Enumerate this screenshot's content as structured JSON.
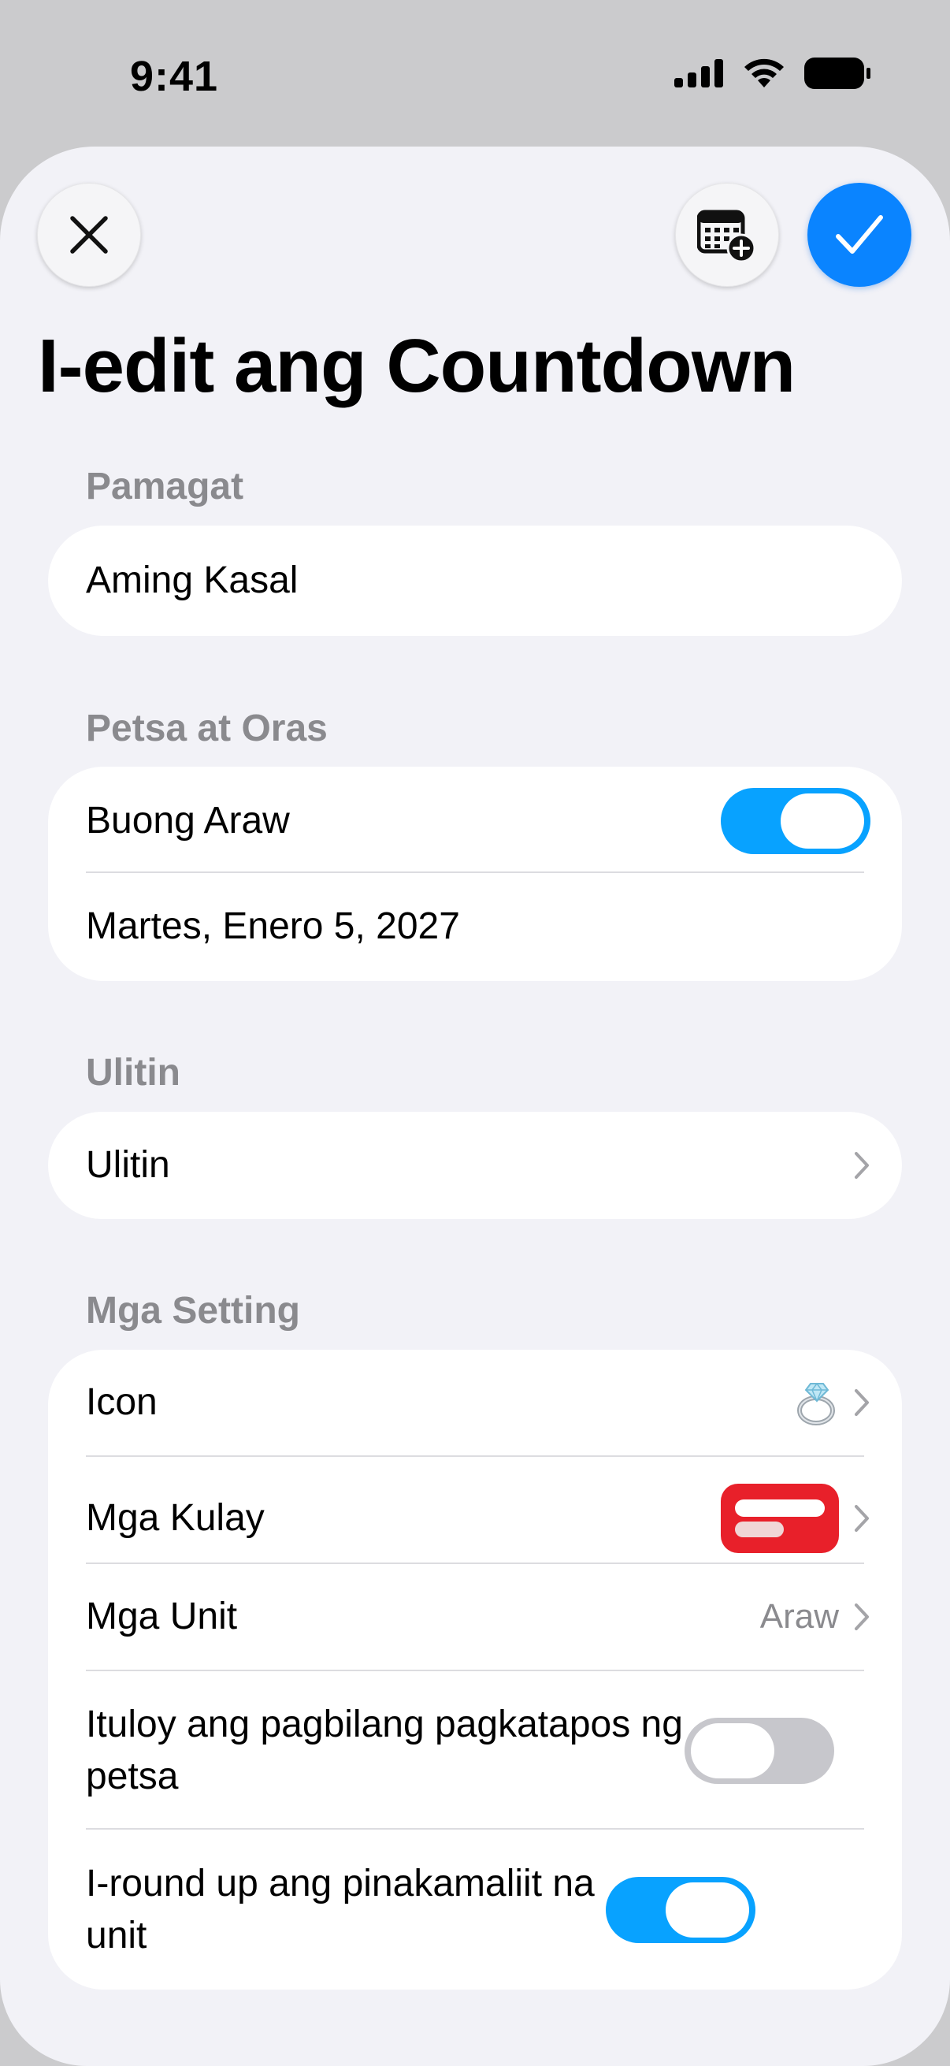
{
  "status_bar": {
    "time": "9:41"
  },
  "header": {
    "title": "I-edit ang Countdown",
    "close_icon": "close-icon",
    "calendar_icon": "calendar-add-icon",
    "confirm_icon": "checkmark-icon",
    "accent_color": "#0a84ff"
  },
  "sections": {
    "title": {
      "label": "Pamagat",
      "input_value": "Aming Kasal"
    },
    "date_time": {
      "label": "Petsa at Oras",
      "all_day_label": "Buong Araw",
      "all_day_on": true,
      "date_text": "Martes, Enero 5, 2027"
    },
    "repeat": {
      "label": "Ulitin",
      "row_label": "Ulitin"
    },
    "settings": {
      "label": "Mga Setting",
      "icon_label": "Icon",
      "icon_value": "ring-icon",
      "colors_label": "Mga Kulay",
      "color_value": "#e8202a",
      "units_label": "Mga Unit",
      "units_value": "Araw",
      "continue_label": "Ituloy ang pagbilang pagkatapos ng petsa",
      "continue_on": false,
      "round_label": "I-round up ang pinakamaliit na unit",
      "round_on": true
    }
  }
}
